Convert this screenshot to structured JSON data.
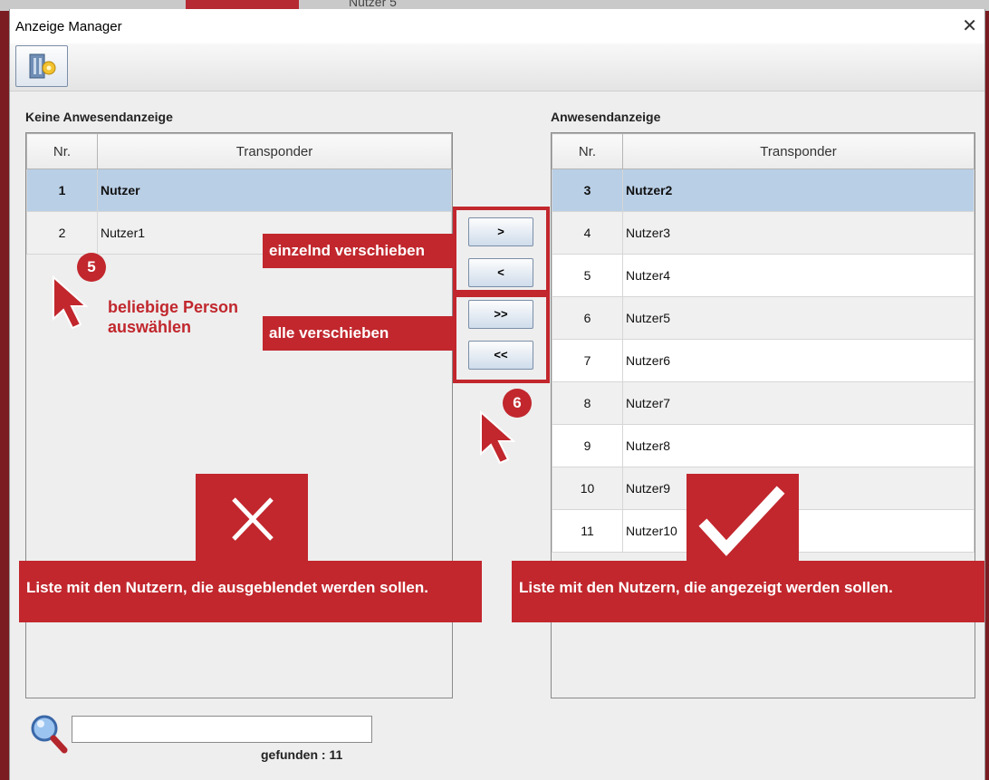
{
  "background": {
    "tab_label": "Nutzer 5"
  },
  "window": {
    "title": "Anzeige Manager",
    "close_glyph": "✕"
  },
  "toolbar": {
    "button_icon": "users-settings-icon"
  },
  "left": {
    "label": "Keine Anwesendanzeige",
    "headers": {
      "nr": "Nr.",
      "name": "Transponder"
    },
    "rows": [
      {
        "nr": "1",
        "name": "Nutzer"
      },
      {
        "nr": "2",
        "name": "Nutzer1"
      }
    ]
  },
  "right": {
    "label": "Anwesendanzeige",
    "headers": {
      "nr": "Nr.",
      "name": "Transponder"
    },
    "rows": [
      {
        "nr": "3",
        "name": "Nutzer2"
      },
      {
        "nr": "4",
        "name": "Nutzer3"
      },
      {
        "nr": "5",
        "name": "Nutzer4"
      },
      {
        "nr": "6",
        "name": "Nutzer5"
      },
      {
        "nr": "7",
        "name": "Nutzer6"
      },
      {
        "nr": "8",
        "name": "Nutzer7"
      },
      {
        "nr": "9",
        "name": "Nutzer8"
      },
      {
        "nr": "10",
        "name": "Nutzer9"
      },
      {
        "nr": "11",
        "name": "Nutzer10"
      }
    ]
  },
  "move_buttons": {
    "one_right": ">",
    "one_left": "<",
    "all_right": ">>",
    "all_left": "<<"
  },
  "annotations": {
    "single_move": "einzelnd verschieben",
    "all_move": "alle verschieben",
    "select_line1": "beliebige Person",
    "select_line2": "auswählen",
    "badge5": "5",
    "badge6": "6",
    "left_caption": "Liste mit den Nutzern, die ausgeblendet werden sollen.",
    "right_caption": "Liste mit den Nutzern, die angezeigt werden sollen."
  },
  "search": {
    "value": "",
    "found_label": "gefunden :",
    "found_count": "11"
  },
  "colors": {
    "accent_red": "#c1272d",
    "selection_blue": "#b9cfe6"
  }
}
